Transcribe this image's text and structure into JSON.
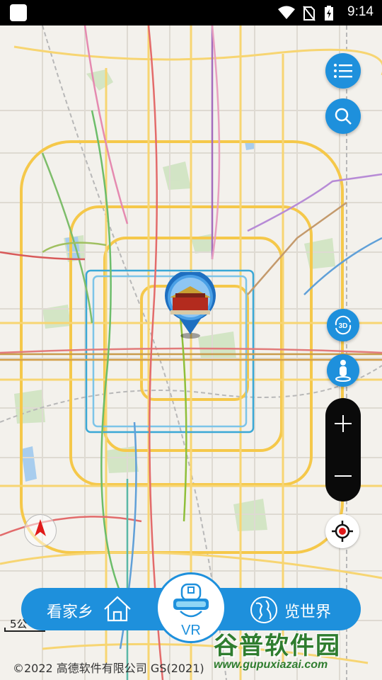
{
  "status_bar": {
    "time": "9:14",
    "icons": [
      "app-icon",
      "wifi-icon",
      "no-sim-icon",
      "battery-charging-icon"
    ]
  },
  "map": {
    "location_pin": "tiananmen-landmark-pin",
    "compass_icon": "north-arrow-icon",
    "scale_label": "5公"
  },
  "controls": {
    "list_icon": "list-icon",
    "search_icon": "search-icon",
    "view_3d_label": "3D",
    "street_view_icon": "person-icon",
    "zoom_in_icon": "plus-icon",
    "zoom_out_icon": "minus-icon",
    "locate_icon": "crosshair-icon"
  },
  "bottom_bar": {
    "left_label": "看家乡",
    "left_icon": "home-icon",
    "center_label": "VR",
    "center_icon": "vr-headset-icon",
    "right_label": "览世界",
    "right_icon": "globe-icon"
  },
  "footer": {
    "copyright": "©2022 高德软件有限公司 GS(2021)"
  },
  "watermark": {
    "title": "谷普软件园",
    "url": "www.gupuxiazai.com"
  },
  "colors": {
    "accent": "#1e90dc",
    "map_background": "#f3f1ec",
    "ring_road": "#f5c84a",
    "watermark_green": "#2f7d2f"
  }
}
